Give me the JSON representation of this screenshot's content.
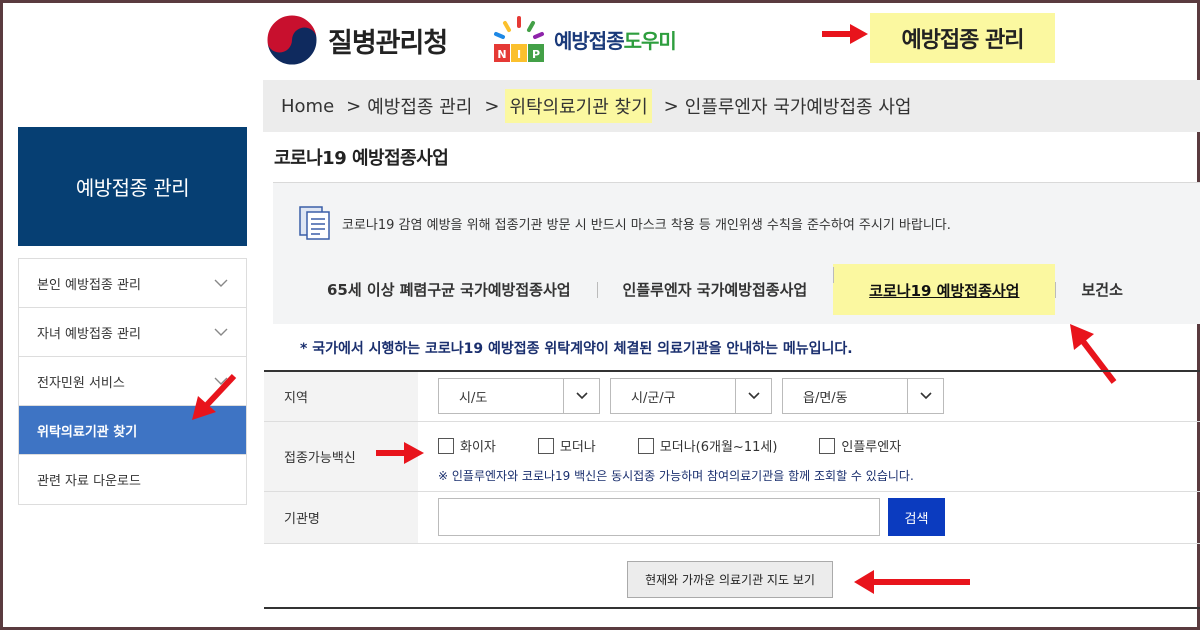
{
  "header": {
    "kdca_name": "질병관리청",
    "nip_badge": "NIP",
    "nip_name_a": "예방접종",
    "nip_name_b": "도우미",
    "highlight_title": "예방접종 관리"
  },
  "breadcrumb": {
    "items": [
      "Home",
      "예방접종 관리",
      "위탁의료기관 찾기",
      "인플루엔자 국가예방접종 사업"
    ],
    "separator": ">"
  },
  "page_title": "코로나19 예방접종사업",
  "notice": {
    "text": "코로나19 감염 예방을 위해 접종기관 방문 시 반드시 마스크 착용 등 개인위생 수칙을 준수하여 주시기 바랍니다."
  },
  "tabs": [
    {
      "label": "65세 이상 폐렴구균 국가예방접종사업"
    },
    {
      "label": "인플루엔자 국가예방접종사업"
    },
    {
      "label": "코로나19 예방접종사업"
    },
    {
      "label": "보건소"
    }
  ],
  "info_text": "* 국가에서 시행하는 코로나19 예방접종 위탁계약이 체결된 의료기관을 안내하는 메뉴입니다.",
  "form": {
    "region_label": "지역",
    "region_selects": [
      "시/도",
      "시/군/구",
      "읍/면/동"
    ],
    "vaccine_label": "접종가능백신",
    "vaccines": [
      "화이자",
      "모더나",
      "모더나(6개월~11세)",
      "인플루엔자"
    ],
    "vaccine_note": "※ 인플루엔자와 코로나19 백신은 동시접종 가능하며 참여의료기관을 함께 조회할 수 있습니다.",
    "name_label": "기관명",
    "name_value": "",
    "search_label": "검색",
    "map_button": "현재와 가까운 의료기관 지도 보기"
  },
  "sidebar": {
    "title": "예방접종 관리",
    "items": [
      {
        "label": "본인 예방접종 관리"
      },
      {
        "label": "자녀 예방접종 관리"
      },
      {
        "label": "전자민원 서비스"
      },
      {
        "label": "위탁의료기관 찾기"
      },
      {
        "label": "관련 자료 다운로드"
      }
    ]
  },
  "colors": {
    "highlight": "#fbf8a0",
    "sidebar_head": "#063f73",
    "sidebar_active": "#3e74c4",
    "search_button": "#0b3bbf",
    "arrow": "#e8141c"
  }
}
